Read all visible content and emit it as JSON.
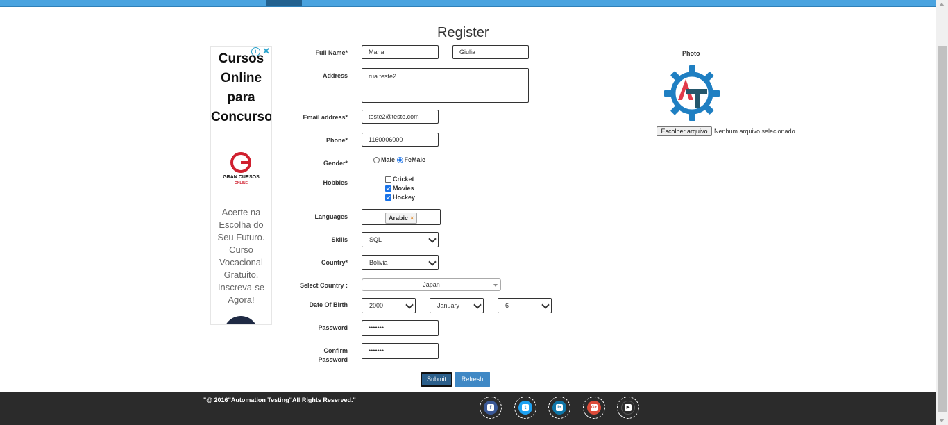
{
  "page": {
    "title": "Register"
  },
  "ad": {
    "headline": "Cursos Online para Concursos",
    "brand_name": "GRAN CURSOS",
    "brand_sub": "ONLINE",
    "body": "Acerte na Escolha do Seu Futuro. Curso Vocacional Gratuito. Inscreva-se Agora!",
    "info_icon": "info-icon",
    "close_icon": "close-icon"
  },
  "form": {
    "full_name_label": "Full Name*",
    "first_name": "Maria",
    "last_name": "Giulia",
    "address_label": "Address",
    "address": "rua teste2",
    "email_label": "Email address*",
    "email": "teste2@teste.com",
    "phone_label": "Phone*",
    "phone": "1160006000",
    "gender_label": "Gender*",
    "gender_options": [
      "Male",
      "FeMale"
    ],
    "gender_selected": "FeMale",
    "hobbies_label": "Hobbies",
    "hobbies": [
      {
        "label": "Cricket",
        "checked": false
      },
      {
        "label": "Movies",
        "checked": true
      },
      {
        "label": "Hockey",
        "checked": true
      }
    ],
    "languages_label": "Languages",
    "language_tag": "Arabic",
    "skills_label": "Skills",
    "skills_value": "SQL",
    "country_label": "Country*",
    "country_value": "Bolivia",
    "select_country_label": "Select Country :",
    "select_country_value": "Japan",
    "dob_label": "Date Of Birth",
    "dob_year": "2000",
    "dob_month": "January",
    "dob_day": "6",
    "password_label": "Password",
    "password": "•••••••",
    "confirm_label_1": "Confirm",
    "confirm_label_2": "Password",
    "confirm_password": "•••••••",
    "submit_label": "Submit",
    "refresh_label": "Refresh"
  },
  "photo": {
    "label": "Photo",
    "file_button": "Escolher arquivo",
    "file_status": "Nenhum arquivo selecionado"
  },
  "footer": {
    "copyright": "\"@ 2016\"Automation Testing\"All Rights Reserved.\"",
    "social": [
      {
        "icon": "facebook-icon",
        "color": "#3b5998",
        "glyph": "f"
      },
      {
        "icon": "twitter-icon",
        "color": "#1da1f2",
        "glyph": "t"
      },
      {
        "icon": "linkedin-icon",
        "color": "#0e76a8",
        "glyph": "in"
      },
      {
        "icon": "googleplus-icon",
        "color": "#dd4b39",
        "glyph": "G+"
      },
      {
        "icon": "youtube-icon",
        "color": "#2b2b2b",
        "glyph": "▶"
      }
    ]
  },
  "colors": {
    "nav": "#4aa3df",
    "nav_active": "#22618f",
    "submit": "#2b5f8b",
    "refresh": "#3f88c5",
    "footer": "#2b2b2b"
  }
}
